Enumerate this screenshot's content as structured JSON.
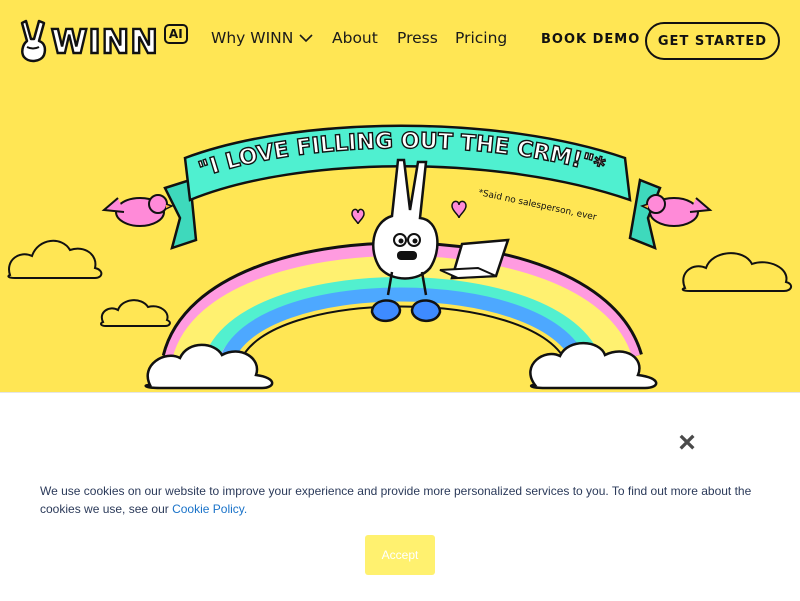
{
  "nav": {
    "logo_text": "WINN",
    "logo_badge": "AI",
    "why": "Why WINN",
    "about": "About",
    "press": "Press",
    "pricing": "Pricing",
    "book_demo": "BOOK DEMO",
    "get_started": "GET STARTED"
  },
  "hero": {
    "banner_text": "\"I LOVE FILLING OUT THE CRM!\"*",
    "footnote": "*Said no salesperson, ever"
  },
  "cookie": {
    "text": "We use cookies on our website to improve your experience and provide more personalized services to you. To find out more about the cookies we use, see our ",
    "link": "Cookie Policy.",
    "accept": "Accept",
    "close_icon": "close-icon"
  },
  "colors": {
    "hero_bg": "#FFE654",
    "banner": "#4FF0D0",
    "accept_bg": "#FFF16F",
    "link": "#1a73c9"
  }
}
